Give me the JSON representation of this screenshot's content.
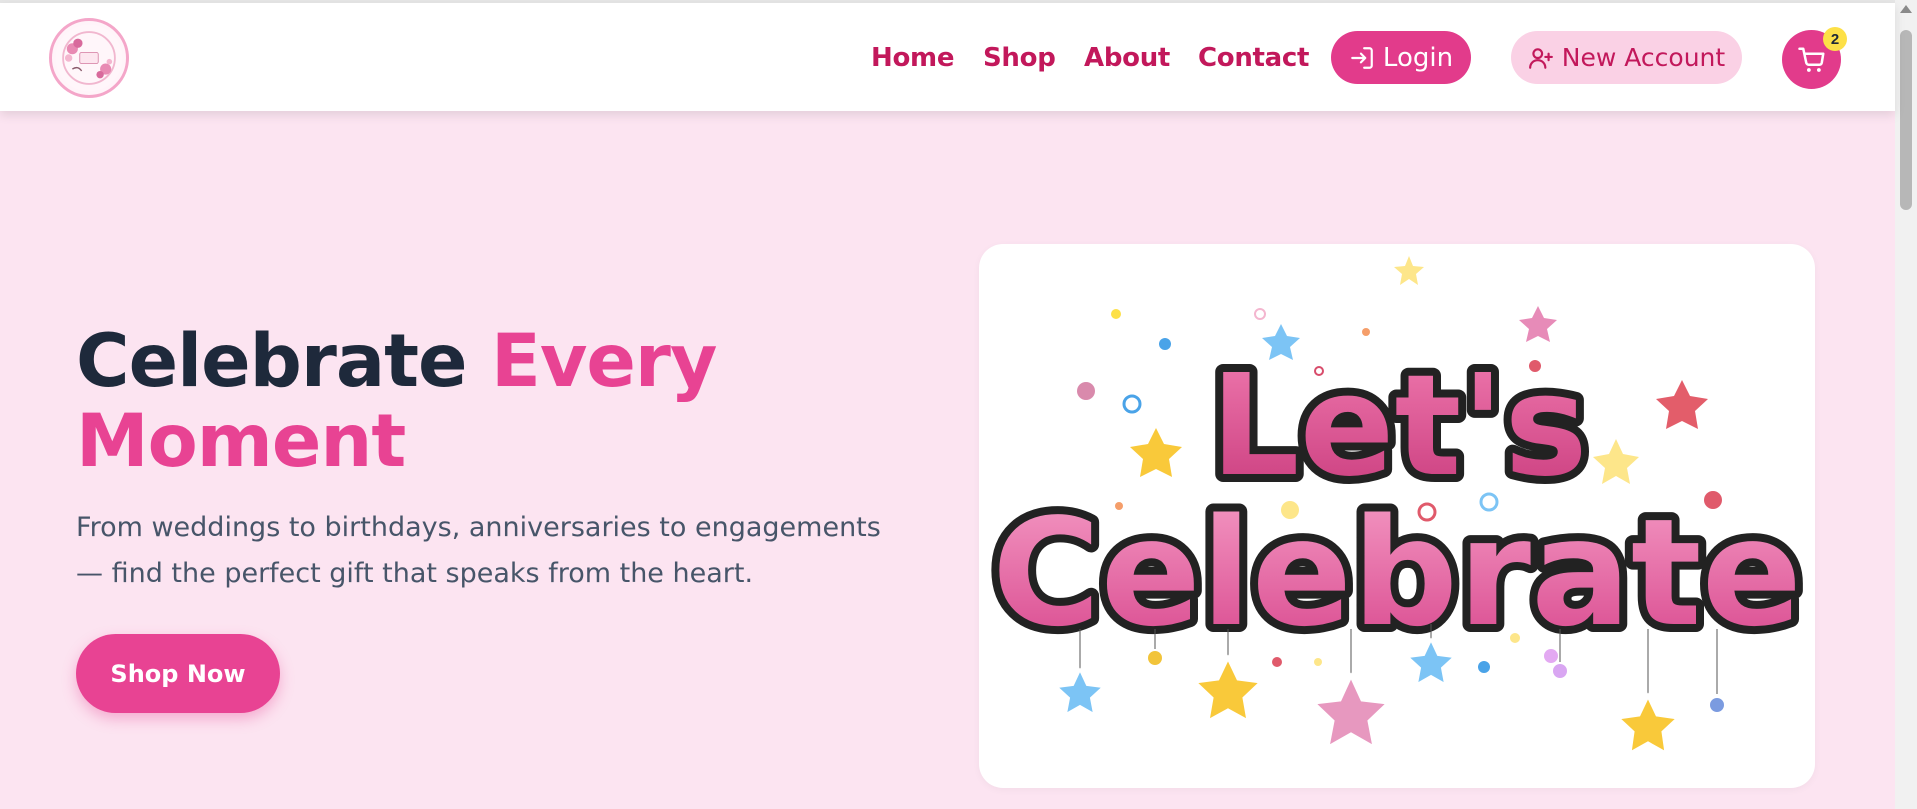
{
  "header": {
    "logo_alt": "shop logo",
    "nav": {
      "home": "Home",
      "shop": "Shop",
      "about": "About",
      "contact": "Contact"
    },
    "login_label": "Login",
    "new_account_label": "New Account",
    "cart_count": "2",
    "icons": {
      "login": "login-arrow-icon",
      "new_account": "user-plus-icon",
      "cart": "cart-icon"
    }
  },
  "hero": {
    "title_part1": "Celebrate ",
    "title_part2": "Every Moment",
    "subtitle": "From weddings to birthdays, anniversaries to engagements — find the perfect gift that speaks from the heart.",
    "cta_label": "Shop Now",
    "image_text_line1": "Let's",
    "image_text_line2": "Celebrate"
  },
  "colors": {
    "brand_pink": "#e84393",
    "nav_text": "#c2185b",
    "hero_bg": "#fce4f1",
    "title_dark": "#1e293b",
    "badge_yellow": "#fde047"
  }
}
